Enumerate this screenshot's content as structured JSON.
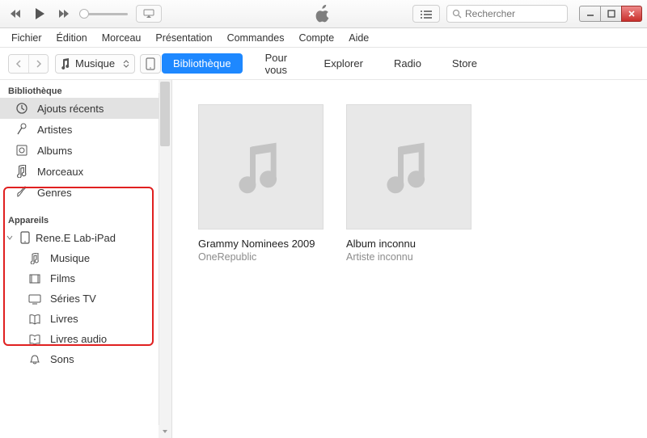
{
  "search": {
    "placeholder": "Rechercher"
  },
  "menu": [
    "Fichier",
    "Édition",
    "Morceau",
    "Présentation",
    "Commandes",
    "Compte",
    "Aide"
  ],
  "mediaPicker": {
    "label": "Musique"
  },
  "tabs": [
    "Bibliothèque",
    "Pour vous",
    "Explorer",
    "Radio",
    "Store"
  ],
  "activeTab": 0,
  "sidebar": {
    "bibliotheque": {
      "header": "Bibliothèque",
      "items": [
        "Ajouts récents",
        "Artistes",
        "Albums",
        "Morceaux",
        "Genres"
      ],
      "selectedIndex": 0
    },
    "appareils": {
      "header": "Appareils",
      "device": "Rene.E Lab-iPad",
      "children": [
        "Musique",
        "Films",
        "Séries TV",
        "Livres",
        "Livres audio",
        "Sons"
      ]
    }
  },
  "albums": [
    {
      "title": "Grammy Nominees 2009",
      "artist": "OneRepublic"
    },
    {
      "title": "Album inconnu",
      "artist": "Artiste inconnu"
    }
  ]
}
